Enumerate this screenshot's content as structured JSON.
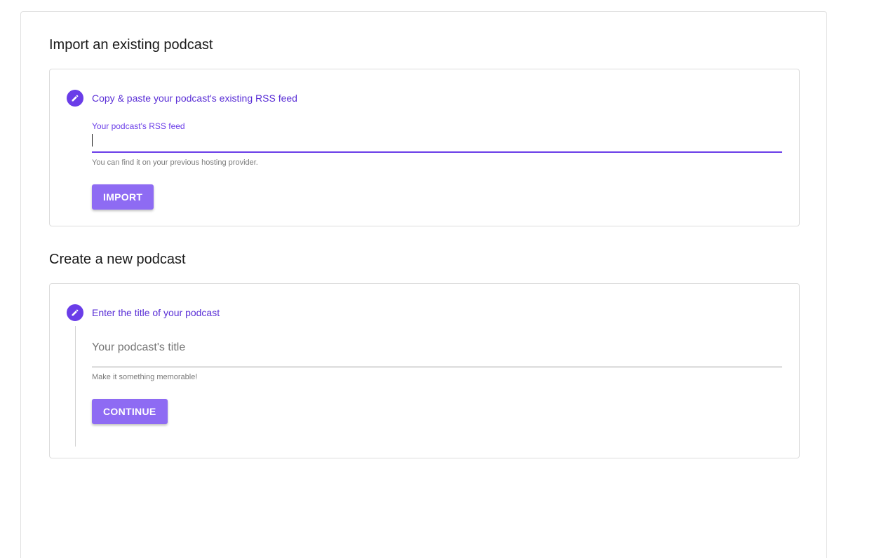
{
  "import_section": {
    "title": "Import an existing podcast",
    "step_label": "Copy & paste your podcast's existing RSS feed",
    "field_label": "Your podcast's RSS feed",
    "input_value": "",
    "helper_text": "You can find it on your previous hosting provider.",
    "button_label": "IMPORT",
    "step_icon": "pencil-icon"
  },
  "create_section": {
    "title": "Create a new podcast",
    "step_label": "Enter the title of your podcast",
    "input_placeholder": "Your podcast's title",
    "input_value": "",
    "helper_text": "Make it something memorable!",
    "button_label": "CONTINUE",
    "step_icon": "pencil-icon"
  },
  "colors": {
    "accent": "#6a3de8",
    "button": "#8e6bf3",
    "label": "#5a2fd6"
  }
}
